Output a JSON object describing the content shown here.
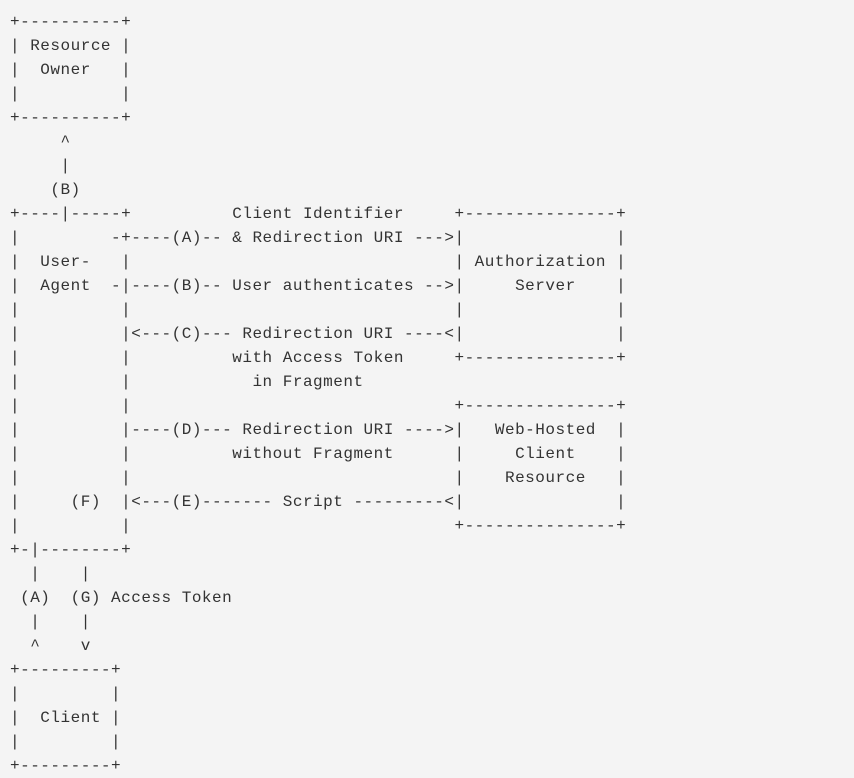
{
  "diagram": {
    "type": "ascii-flow",
    "boxes": {
      "resource_owner": "Resource\nOwner",
      "user_agent": "User-\nAgent",
      "authorization_server": "Authorization\nServer",
      "web_hosted_client_resource": "Web-Hosted\nClient\nResource",
      "client": "Client"
    },
    "flows": {
      "A_to_auth": "Client Identifier\n& Redirection URI",
      "B_to_auth": "User authenticates",
      "C_from_auth": "Redirection URI\nwith Access Token\nin Fragment",
      "D_to_webhosted": "Redirection URI\nwithout Fragment",
      "E_from_webhosted": "Script",
      "G_label": "Access Token"
    },
    "step_labels": [
      "(A)",
      "(B)",
      "(C)",
      "(D)",
      "(E)",
      "(F)",
      "(G)"
    ],
    "ascii": "+----------+\n| Resource |\n|  Owner   |\n|          |\n+----------+\n     ^\n     |\n    (B)\n+----|-----+          Client Identifier     +---------------+\n|         -+----(A)-- & Redirection URI --->|               |\n|  User-   |                                | Authorization |\n|  Agent  -|----(B)-- User authenticates -->|     Server    |\n|          |                                |               |\n|          |<---(C)--- Redirection URI ----<|               |\n|          |          with Access Token     +---------------+\n|          |            in Fragment\n|          |                                +---------------+\n|          |----(D)--- Redirection URI ---->|   Web-Hosted  |\n|          |          without Fragment      |     Client    |\n|          |                                |    Resource   |\n|     (F)  |<---(E)------- Script ---------<|               |\n|          |                                +---------------+\n+-|--------+\n  |    |\n (A)  (G) Access Token\n  |    |\n  ^    v\n+---------+\n|         |\n|  Client |\n|         |\n+---------+"
  }
}
